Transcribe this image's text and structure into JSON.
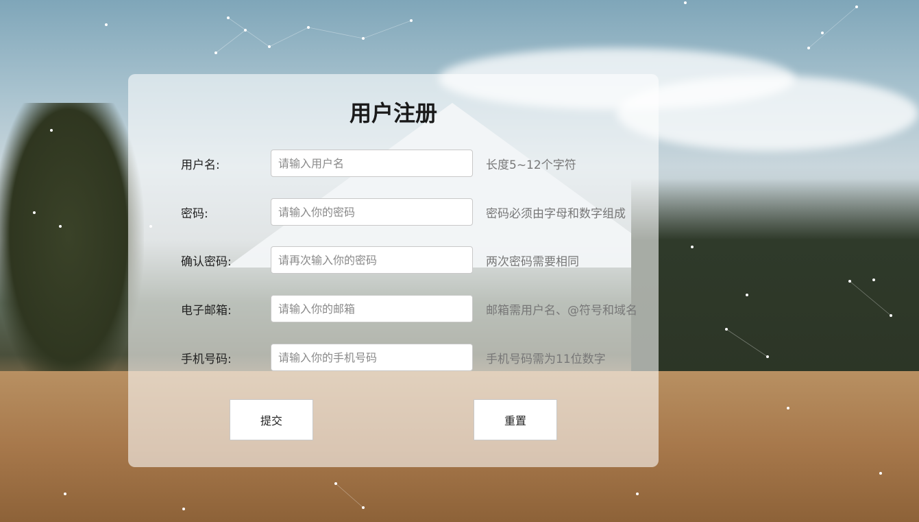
{
  "form": {
    "title": "用户注册",
    "fields": [
      {
        "label": "用户名:",
        "placeholder": "请输入用户名",
        "hint": "长度5~12个字符"
      },
      {
        "label": "密码:",
        "placeholder": "请输入你的密码",
        "hint": "密码必须由字母和数字组成"
      },
      {
        "label": "确认密码:",
        "placeholder": "请再次输入你的密码",
        "hint": "两次密码需要相同"
      },
      {
        "label": "电子邮箱:",
        "placeholder": "请输入你的邮箱",
        "hint": "邮箱需用户名、@符号和域名"
      },
      {
        "label": "手机号码:",
        "placeholder": "请输入你的手机号码",
        "hint": "手机号码需为11位数字"
      }
    ],
    "submit_label": "提交",
    "reset_label": "重置"
  }
}
